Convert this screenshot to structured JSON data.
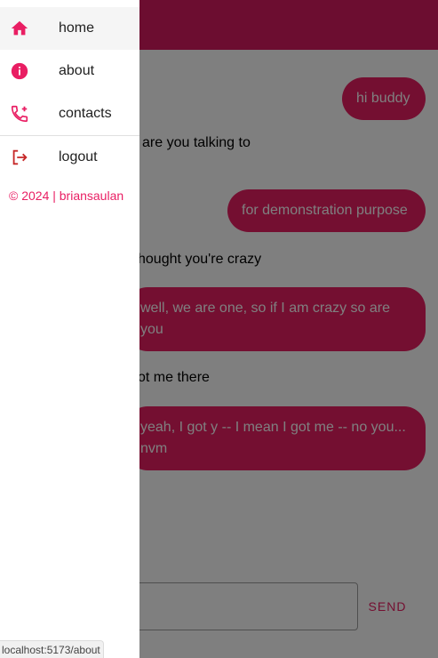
{
  "colors": {
    "primary": "#e91e63",
    "appbar": "#d81b60",
    "overlay": "rgba(0,0,0,0.5)"
  },
  "nav": {
    "items": [
      {
        "label": "home",
        "icon": "home-icon"
      },
      {
        "label": "about",
        "icon": "info-icon"
      },
      {
        "label": "contacts",
        "icon": "phone-add-icon"
      },
      {
        "label": "logout",
        "icon": "logout-icon"
      }
    ],
    "copyright": "© 2024 | briansaulan"
  },
  "messages": [
    {
      "from": "me",
      "text": "hi buddy"
    },
    {
      "from": "other",
      "text": "are you talking to"
    },
    {
      "from": "me",
      "text": "for demonstration purpose"
    },
    {
      "from": "other",
      "text": "hought you're crazy"
    },
    {
      "from": "me",
      "text": "well, we are one, so if I am crazy so are you"
    },
    {
      "from": "other",
      "text": "ot me there"
    },
    {
      "from": "me",
      "text": "yeah, I got y -- I mean I got me -- no you... nvm"
    }
  ],
  "composer": {
    "send_label": "SEND"
  },
  "status_url": "localhost:5173/about"
}
